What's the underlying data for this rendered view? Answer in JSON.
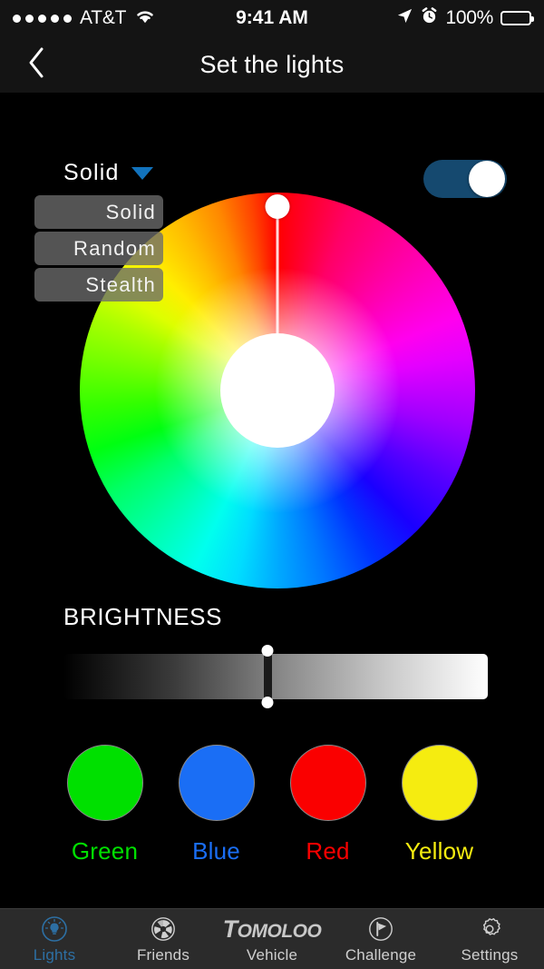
{
  "status_bar": {
    "signal_dots": 5,
    "carrier": "AT&T",
    "wifi_icon": "wifi-icon",
    "time": "9:41 AM",
    "location_icon": "location-arrow-icon",
    "alarm_icon": "alarm-clock-icon",
    "battery_percent": "100%",
    "battery_icon": "battery-full-icon"
  },
  "nav": {
    "back_icon": "chevron-left-icon",
    "title": "Set the lights"
  },
  "mode_selector": {
    "selected": "Solid",
    "chevron_icon": "triangle-down-icon",
    "chevron_color": "#1273bd",
    "options": [
      {
        "label": "Solid"
      },
      {
        "label": "Random"
      },
      {
        "label": "Stealth"
      }
    ]
  },
  "power_toggle": {
    "state": "on",
    "track_color": "#15496f",
    "knob_color": "#ffffff"
  },
  "color_wheel": {
    "name": "color-wheel",
    "selected_hue_degrees": 0,
    "selected_color": "#ff0000",
    "handle_position": "top",
    "center_color": "#ffffff"
  },
  "brightness": {
    "label": "BRIGHTNESS",
    "value_percent": 48,
    "gradient_from": "#000000",
    "gradient_to": "#ffffff"
  },
  "presets": [
    {
      "name": "Green",
      "color": "#00e000",
      "label": "Green"
    },
    {
      "name": "Blue",
      "color": "#1a6ef5",
      "label": "Blue"
    },
    {
      "name": "Red",
      "color": "#fa0000",
      "label": "Red"
    },
    {
      "name": "Yellow",
      "color": "#f5ec10",
      "label": "Yellow"
    }
  ],
  "tab_bar": {
    "active": "Lights",
    "active_color": "#2d6fa3",
    "inactive_color": "#cfcfcf",
    "tabs": [
      {
        "label": "Lights",
        "icon": "lightbulb-icon"
      },
      {
        "label": "Friends",
        "icon": "aperture-icon"
      },
      {
        "label": "Vehicle",
        "icon": "tomoloo-logo",
        "logo_big": "T",
        "logo_rest": "OMOLOO"
      },
      {
        "label": "Challenge",
        "icon": "flag-icon"
      },
      {
        "label": "Settings",
        "icon": "gear-icon"
      }
    ]
  }
}
